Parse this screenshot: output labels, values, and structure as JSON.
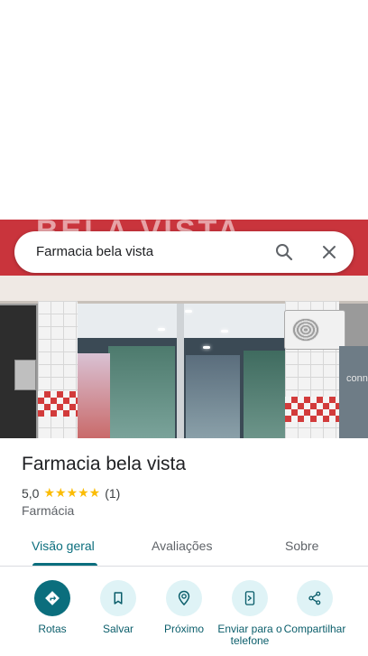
{
  "search": {
    "query": "Farmacia bela vista"
  },
  "photo": {
    "sign_text": "BELA VISTA",
    "glass_text": "conne"
  },
  "place": {
    "name": "Farmacia bela vista",
    "rating": "5,0",
    "stars": "★★★★★",
    "review_count": "(1)",
    "category": "Farmácia"
  },
  "tabs": [
    {
      "label": "Visão geral",
      "active": true
    },
    {
      "label": "Avaliações",
      "active": false
    },
    {
      "label": "Sobre",
      "active": false
    }
  ],
  "actions": [
    {
      "label": "Rotas",
      "icon": "directions-icon"
    },
    {
      "label": "Salvar",
      "icon": "bookmark-icon"
    },
    {
      "label": "Próximo",
      "icon": "nearby-icon"
    },
    {
      "label": "Enviar para o telefone",
      "icon": "send-to-phone-icon"
    },
    {
      "label": "Compartilhar",
      "icon": "share-icon"
    }
  ],
  "colors": {
    "accent": "#0b6e7d",
    "accent_light": "#dff3f6",
    "star": "#fbbc04"
  }
}
